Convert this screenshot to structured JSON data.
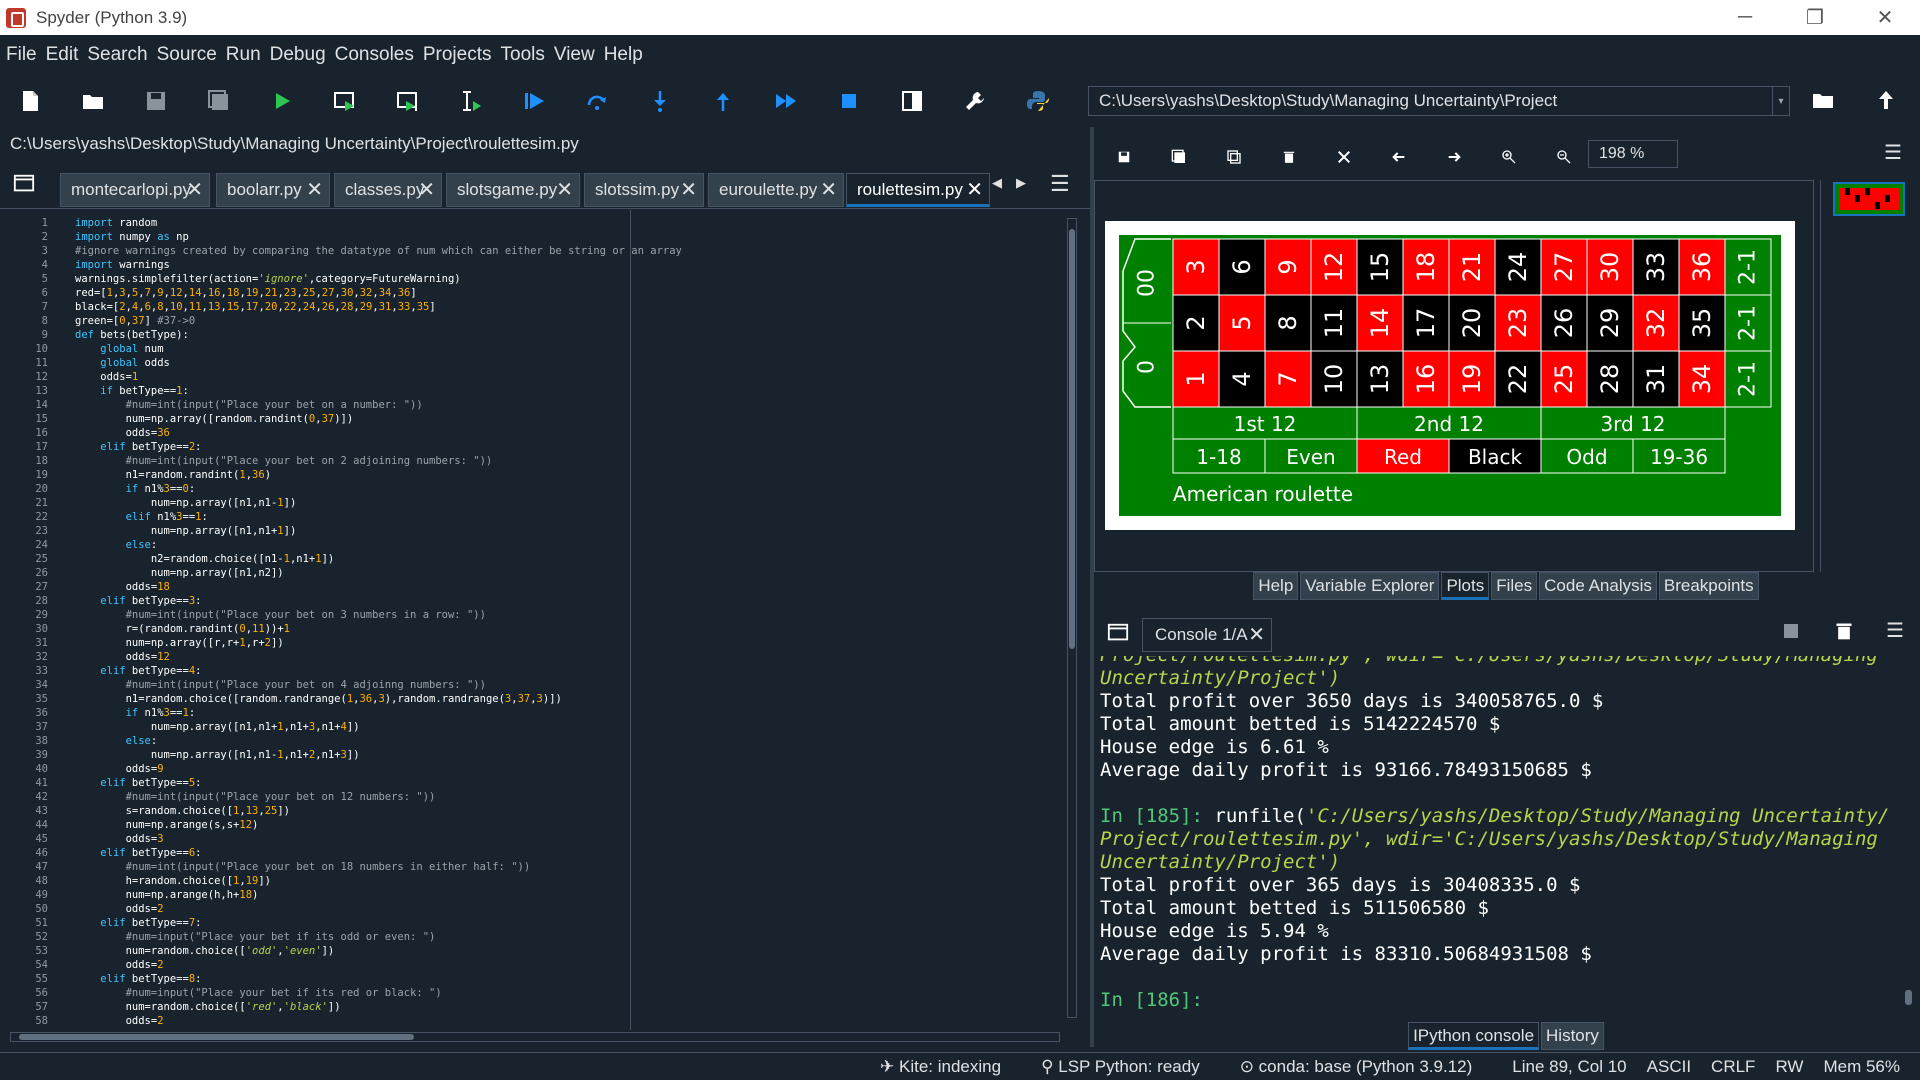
{
  "window": {
    "title": "Spyder (Python 3.9)",
    "minimize": "─",
    "restore": "❐",
    "close": "✕"
  },
  "menu": [
    "File",
    "Edit",
    "Search",
    "Source",
    "Run",
    "Debug",
    "Consoles",
    "Projects",
    "Tools",
    "View",
    "Help"
  ],
  "working_dir": "C:\\Users\\yashs\\Desktop\\Study\\Managing Uncertainty\\Project",
  "editor": {
    "path": "C:\\Users\\yashs\\Desktop\\Study\\Managing Uncertainty\\Project\\roulettesim.py",
    "tabs": [
      "montecarlopi.py",
      "boolarr.py",
      "classes.py",
      "slotsgame.py",
      "slotssim.py",
      "euroulette.py",
      "roulettesim.py"
    ],
    "active_tab": "roulettesim.py",
    "lines": [
      "import random",
      "import numpy as np",
      "#ignore warnings created by comparing the datatype of num which can either be string or an array",
      "import warnings",
      "warnings.simplefilter(action='ignore',category=FutureWarning)",
      "red=[1,3,5,7,9,12,14,16,18,19,21,23,25,27,30,32,34,36]",
      "black=[2,4,6,8,10,11,13,15,17,20,22,24,26,28,29,31,33,35]",
      "green=[0,37] #37->0",
      "def bets(betType):",
      "    global num",
      "    global odds",
      "    odds=1",
      "    if betType==1:",
      "        #num=int(input(\"Place your bet on a number: \"))",
      "        num=np.array([random.randint(0,37)])",
      "        odds=36",
      "    elif betType==2:",
      "        #num=int(input(\"Place your bet on 2 adjoining numbers: \"))",
      "        n1=random.randint(1,36)",
      "        if n1%3==0:",
      "            num=np.array([n1,n1-1])",
      "        elif n1%3==1:",
      "            num=np.array([n1,n1+1])",
      "        else:",
      "            n2=random.choice([n1-1,n1+1])",
      "            num=np.array([n1,n2])",
      "        odds=18",
      "    elif betType==3:",
      "        #num=int(input(\"Place your bet on 3 numbers in a row: \"))",
      "        r=(random.randint(0,11))+1",
      "        num=np.array([r,r+1,r+2])",
      "        odds=12",
      "    elif betType==4:",
      "        #num=int(input(\"Place your bet on 4 adjoinng numbers: \"))",
      "        n1=random.choice([random.randrange(1,36,3),random.randrange(3,37,3)])",
      "        if n1%3==1:",
      "            num=np.array([n1,n1+1,n1+3,n1+4])",
      "        else:",
      "            num=np.array([n1,n1-1,n1+2,n1+3])",
      "        odds=9",
      "    elif betType==5:",
      "        #num=int(input(\"Place your bet on 12 numbers: \"))",
      "        s=random.choice([1,13,25])",
      "        num=np.arange(s,s+12)",
      "        odds=3",
      "    elif betType==6:",
      "        #num=int(input(\"Place your bet on 18 numbers in either half: \"))",
      "        h=random.choice([1,19])",
      "        num=np.arange(h,h+18)",
      "        odds=2",
      "    elif betType==7:",
      "        #num=input(\"Place your bet if its odd or even: \")",
      "        num=random.choice(['odd','even'])",
      "        odds=2",
      "    elif betType==8:",
      "        #num=input(\"Place your bet if its red or black: \")",
      "        num=random.choice(['red','black'])",
      "        odds=2"
    ]
  },
  "plots": {
    "zoom": "198 %",
    "roulette": {
      "top_row": [
        "3",
        "6",
        "9",
        "12",
        "15",
        "18",
        "21",
        "24",
        "27",
        "30",
        "33",
        "36"
      ],
      "mid_row": [
        "2",
        "5",
        "8",
        "11",
        "14",
        "17",
        "20",
        "23",
        "26",
        "29",
        "32",
        "35"
      ],
      "bot_row": [
        "1",
        "4",
        "7",
        "10",
        "13",
        "16",
        "19",
        "22",
        "25",
        "28",
        "31",
        "34"
      ],
      "zeros": [
        "00",
        "0"
      ],
      "column_bets": [
        "2-1",
        "2-1",
        "2-1"
      ],
      "dozens": [
        "1st 12",
        "2nd 12",
        "3rd 12"
      ],
      "outside": [
        "1-18",
        "Even",
        "Red",
        "Black",
        "Odd",
        "19-36"
      ],
      "caption": "American roulette",
      "colors": {
        "red": "#ff0000",
        "black": "#000000",
        "green": "#008000"
      }
    }
  },
  "pane_tabs": [
    "Help",
    "Variable Explorer",
    "Plots",
    "Files",
    "Code Analysis",
    "Breakpoints"
  ],
  "active_pane_tab": "Plots",
  "console": {
    "tab": "Console 1/A",
    "lines": [
      {
        "cls": "yg",
        "text": "Project/roulettesim.py', wdir='C:/Users/yashs/Desktop/Study/Managing"
      },
      {
        "cls": "yg",
        "text": "Uncertainty/Project')"
      },
      {
        "cls": "",
        "text": "Total profit over 3650 days is 340058765.0 $"
      },
      {
        "cls": "",
        "text": "Total amount betted is 5142224570 $"
      },
      {
        "cls": "",
        "text": "House edge is 6.61 %"
      },
      {
        "cls": "",
        "text": "Average daily profit is 93166.78493150685 $"
      },
      {
        "cls": "",
        "text": ""
      },
      {
        "cls": "in",
        "text": "In [185]: runfile('C:/Users/yashs/Desktop/Study/Managing Uncertainty/"
      },
      {
        "cls": "yg",
        "text": "Project/roulettesim.py', wdir='C:/Users/yashs/Desktop/Study/Managing"
      },
      {
        "cls": "yg",
        "text": "Uncertainty/Project')"
      },
      {
        "cls": "",
        "text": "Total profit over 365 days is 30408335.0 $"
      },
      {
        "cls": "",
        "text": "Total amount betted is 511506580 $"
      },
      {
        "cls": "",
        "text": "House edge is 5.94 %"
      },
      {
        "cls": "",
        "text": "Average daily profit is 83310.50684931508 $"
      },
      {
        "cls": "",
        "text": ""
      },
      {
        "cls": "green",
        "text": "In [186]:"
      }
    ]
  },
  "console_tabs": [
    "IPython console",
    "History"
  ],
  "active_console_tab": "IPython console",
  "status": [
    "Kite: indexing",
    "LSP Python: ready",
    "conda: base (Python 3.9.12)",
    "Line 89, Col 10",
    "ASCII",
    "CRLF",
    "RW",
    "Mem 56%"
  ]
}
